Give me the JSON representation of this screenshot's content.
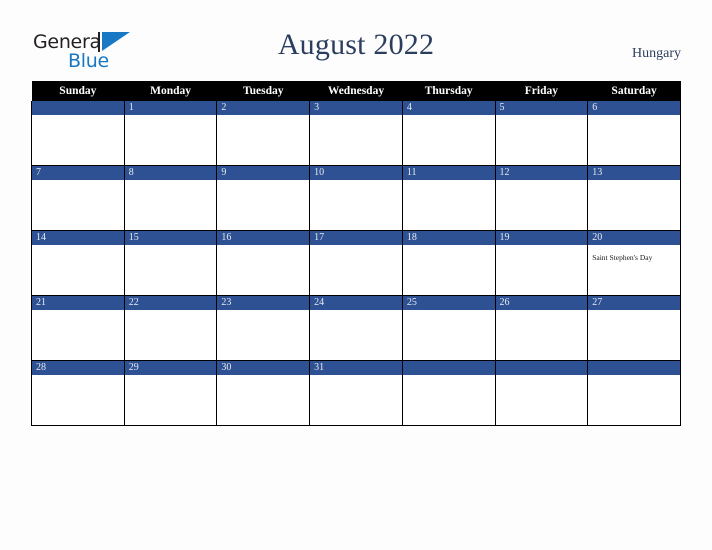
{
  "brand": {
    "name_part1": "General",
    "name_part2": "Blue",
    "mark_color": "#1878c4",
    "text_color": "#231f20"
  },
  "header": {
    "title": "August 2022",
    "country": "Hungary",
    "title_color": "#2c3e5d"
  },
  "theme": {
    "day_bar_color": "#2d5193",
    "weekday_header_bg": "#000000",
    "weekday_header_text": "#ffffff",
    "cell_bg": "#ffffff",
    "page_bg": "#fdfdfd"
  },
  "calendar": {
    "weekdays": [
      "Sunday",
      "Monday",
      "Tuesday",
      "Wednesday",
      "Thursday",
      "Friday",
      "Saturday"
    ],
    "weeks": [
      [
        {
          "day": "",
          "event": ""
        },
        {
          "day": "1",
          "event": ""
        },
        {
          "day": "2",
          "event": ""
        },
        {
          "day": "3",
          "event": ""
        },
        {
          "day": "4",
          "event": ""
        },
        {
          "day": "5",
          "event": ""
        },
        {
          "day": "6",
          "event": ""
        }
      ],
      [
        {
          "day": "7",
          "event": ""
        },
        {
          "day": "8",
          "event": ""
        },
        {
          "day": "9",
          "event": ""
        },
        {
          "day": "10",
          "event": ""
        },
        {
          "day": "11",
          "event": ""
        },
        {
          "day": "12",
          "event": ""
        },
        {
          "day": "13",
          "event": ""
        }
      ],
      [
        {
          "day": "14",
          "event": ""
        },
        {
          "day": "15",
          "event": ""
        },
        {
          "day": "16",
          "event": ""
        },
        {
          "day": "17",
          "event": ""
        },
        {
          "day": "18",
          "event": ""
        },
        {
          "day": "19",
          "event": ""
        },
        {
          "day": "20",
          "event": "Saint Stephen's Day"
        }
      ],
      [
        {
          "day": "21",
          "event": ""
        },
        {
          "day": "22",
          "event": ""
        },
        {
          "day": "23",
          "event": ""
        },
        {
          "day": "24",
          "event": ""
        },
        {
          "day": "25",
          "event": ""
        },
        {
          "day": "26",
          "event": ""
        },
        {
          "day": "27",
          "event": ""
        }
      ],
      [
        {
          "day": "28",
          "event": ""
        },
        {
          "day": "29",
          "event": ""
        },
        {
          "day": "30",
          "event": ""
        },
        {
          "day": "31",
          "event": ""
        },
        {
          "day": "",
          "event": ""
        },
        {
          "day": "",
          "event": ""
        },
        {
          "day": "",
          "event": ""
        }
      ]
    ]
  }
}
